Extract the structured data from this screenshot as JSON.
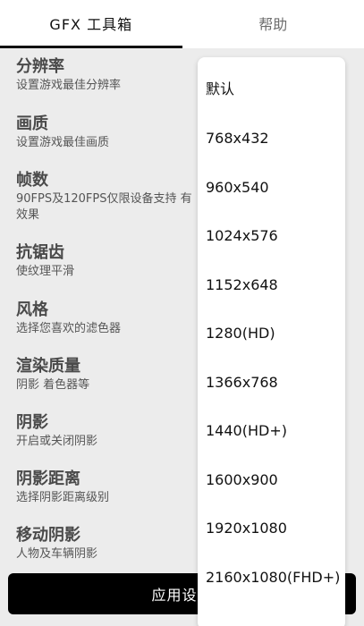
{
  "tabs": [
    {
      "label": "GFX 工具箱",
      "active": true
    },
    {
      "label": "帮助",
      "active": false
    }
  ],
  "settings": [
    {
      "title": "分辨率",
      "desc": "设置游戏最佳分辨率"
    },
    {
      "title": "画质",
      "desc": "设置游戏最佳画质"
    },
    {
      "title": "帧数",
      "desc": "90FPS及120FPS仅限设备支持 有效果"
    },
    {
      "title": "抗锯齿",
      "desc": "使纹理平滑"
    },
    {
      "title": "风格",
      "desc": "选择您喜欢的滤色器"
    },
    {
      "title": "渲染质量",
      "desc": "阴影 着色器等"
    },
    {
      "title": "阴影",
      "desc": "开启或关闭阴影"
    },
    {
      "title": "阴影距离",
      "desc": "选择阴影距离级别"
    },
    {
      "title": "移动阴影",
      "desc": "人物及车辆阴影"
    }
  ],
  "apply_label": "应用设置",
  "resolution_options": [
    "默认",
    "768x432",
    "960x540",
    "1024x576",
    "1152x648",
    "1280(HD)",
    "1366x768",
    "1440(HD+)",
    "1600x900",
    "1920x1080",
    "2160x1080(FHD+)"
  ],
  "colors": {
    "accent": "#000000",
    "background": "#ececec",
    "dropdown": "#ffffff"
  }
}
